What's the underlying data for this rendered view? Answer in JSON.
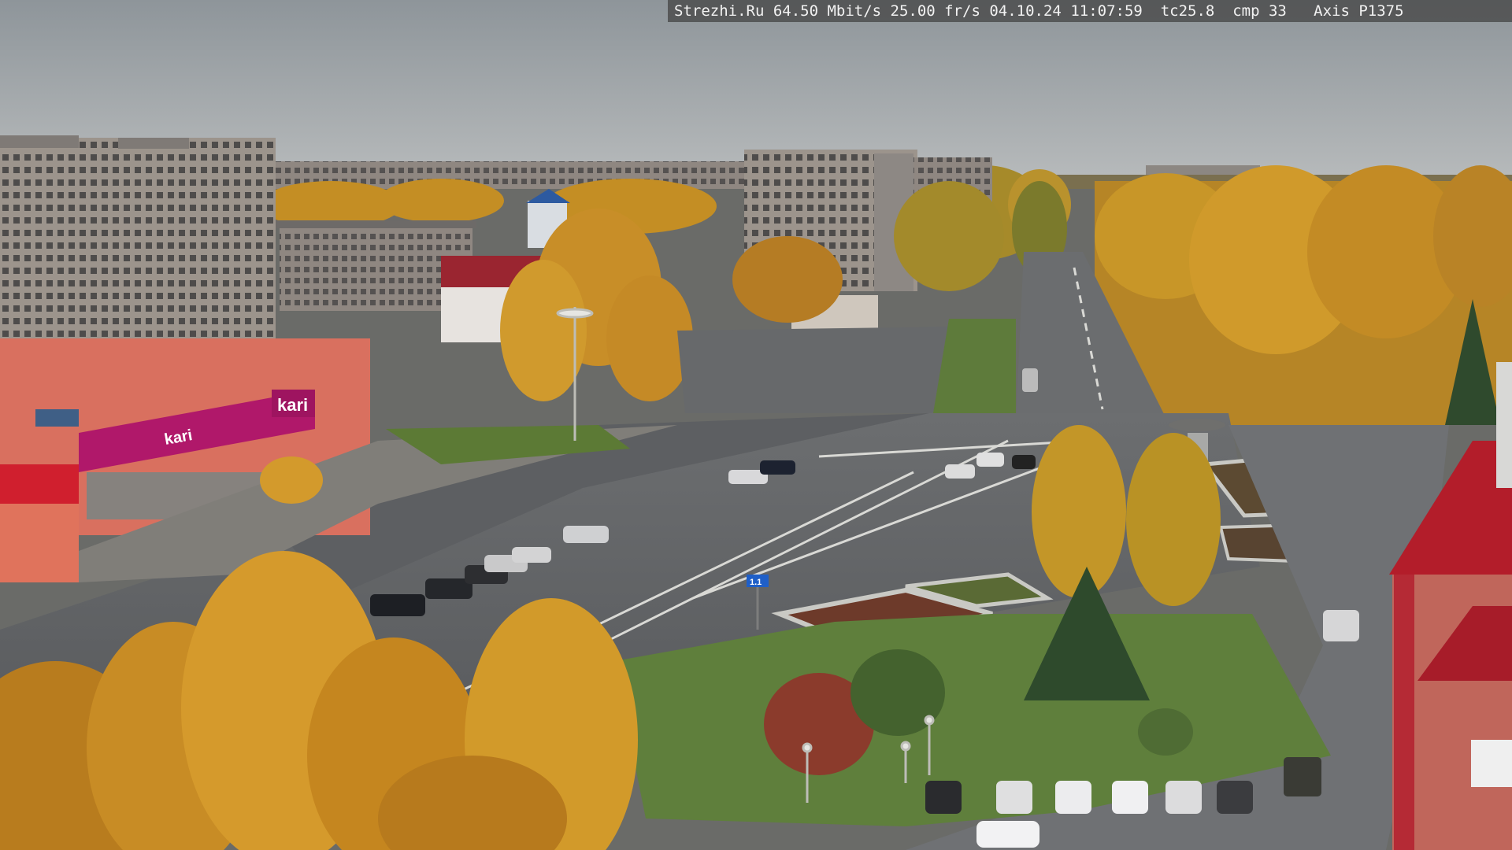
{
  "camera_overlay": {
    "text": "Strezhi.Ru 64.50 Mbit/s 25.00 fr/s 04.10.24 11:07:59  tc25.8  cmp 33   Axis P1375"
  },
  "signs": {
    "store_brand": "kari",
    "store_brand_lower": "kari",
    "road_sign": "1.1"
  },
  "colors": {
    "sky_top": "#8e959a",
    "sky_bottom": "#b9bcbd",
    "asphalt": "#5a5c5f",
    "grass": "#5f7f3c",
    "autumn_foliage": "#c98f22",
    "brand_magenta": "#b0186a",
    "red_roof": "#b31d2a"
  }
}
